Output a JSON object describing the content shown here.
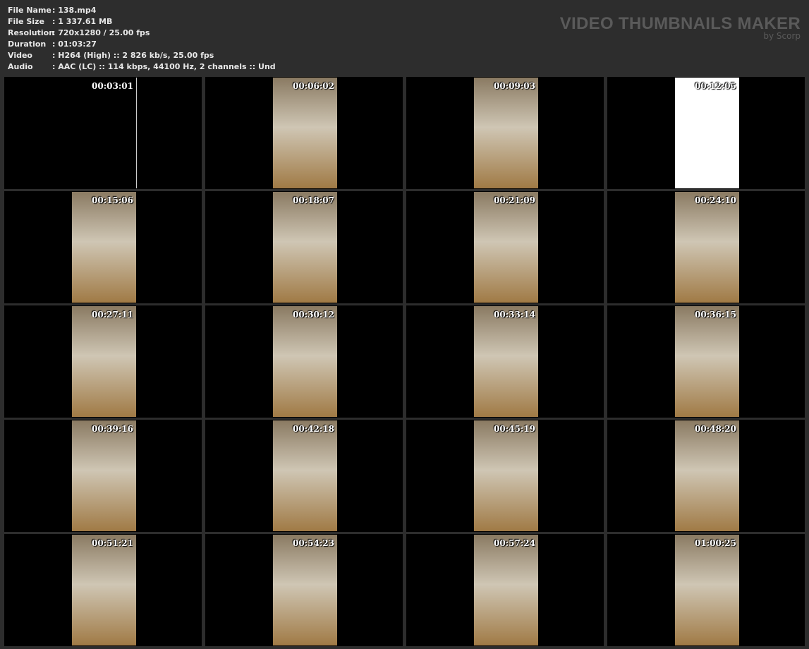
{
  "info": [
    {
      "label": "File Name",
      "value": "138.mp4"
    },
    {
      "label": "File Size",
      "value": "1 337.61 MB"
    },
    {
      "label": "Resolution",
      "value": "720x1280 / 25.00 fps"
    },
    {
      "label": "Duration",
      "value": "01:03:27"
    },
    {
      "label": "Video",
      "value": "H264 (High) :: 2 826 kb/s, 25.00 fps"
    },
    {
      "label": "Audio",
      "value": "AAC (LC) :: 114 kbps, 44100 Hz, 2 channels :: Und"
    }
  ],
  "brand": {
    "title": "VIDEO THUMBNAILS MAKER",
    "sub": "by Scorp"
  },
  "thumbnails": [
    "00:03:01",
    "00:06:02",
    "00:09:03",
    "00:12:05",
    "00:15:06",
    "00:18:07",
    "00:21:09",
    "00:24:10",
    "00:27:11",
    "00:30:12",
    "00:33:14",
    "00:36:15",
    "00:39:16",
    "00:42:18",
    "00:45:19",
    "00:48:20",
    "00:51:21",
    "00:54:23",
    "00:57:24",
    "01:00:25"
  ]
}
